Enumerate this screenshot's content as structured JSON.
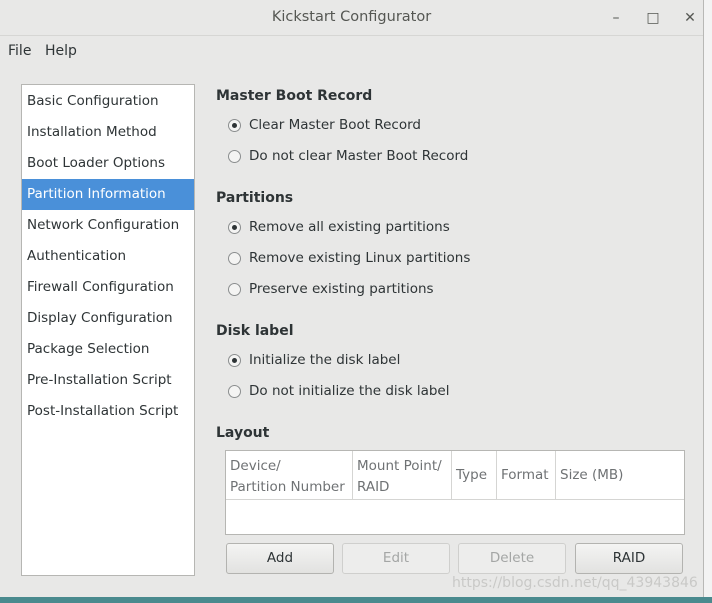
{
  "window": {
    "title": "Kickstart Configurator",
    "controls": {
      "minimize": "–",
      "maximize": "□",
      "close": "✕"
    }
  },
  "menubar": {
    "items": [
      "File",
      "Help"
    ]
  },
  "sidebar": {
    "items": [
      "Basic Configuration",
      "Installation Method",
      "Boot Loader Options",
      "Partition Information",
      "Network Configuration",
      "Authentication",
      "Firewall Configuration",
      "Display Configuration",
      "Package Selection",
      "Pre-Installation Script",
      "Post-Installation Script"
    ],
    "selected": "Partition Information"
  },
  "mbr": {
    "title": "Master Boot Record",
    "options": [
      "Clear Master Boot Record",
      "Do not clear Master Boot Record"
    ],
    "selected": "Clear Master Boot Record"
  },
  "partitions": {
    "title": "Partitions",
    "options": [
      "Remove all existing partitions",
      "Remove existing Linux partitions",
      "Preserve existing partitions"
    ],
    "selected": "Remove all existing partitions"
  },
  "disklabel": {
    "title": "Disk label",
    "options": [
      "Initialize the disk label",
      "Do not initialize the disk label"
    ],
    "selected": "Initialize the disk label"
  },
  "layout": {
    "title": "Layout",
    "columns": {
      "device_line1": "Device/",
      "device_line2": "Partition Number",
      "mount_line1": "Mount Point/",
      "mount_line2": "RAID",
      "type": "Type",
      "format": "Format",
      "size": "Size (MB)"
    },
    "rows": []
  },
  "buttons": {
    "add": "Add",
    "edit": "Edit",
    "delete": "Delete",
    "raid": "RAID"
  },
  "watermark": "https://blog.csdn.net/qq_43943846",
  "colors": {
    "selection": "#4a90d9",
    "window_bg": "#e8e8e7",
    "desktop": "#2f6f73"
  }
}
